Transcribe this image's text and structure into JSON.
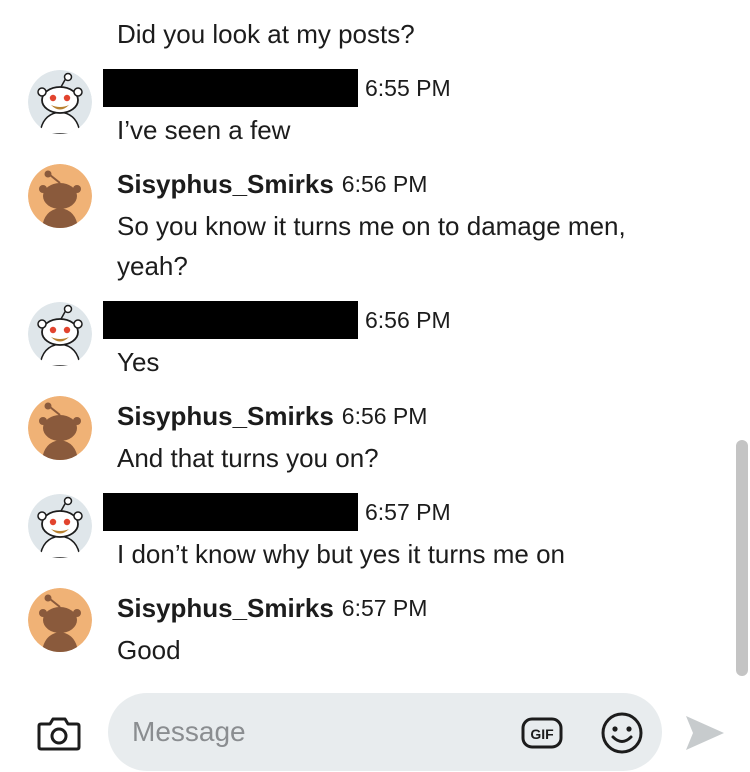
{
  "messages": [
    {
      "type": "continuation",
      "text": "Did you look at my posts?"
    },
    {
      "type": "message",
      "sender": "other",
      "username": "",
      "redacted": true,
      "time": "6:55 PM",
      "text": "I’ve seen a few"
    },
    {
      "type": "message",
      "sender": "self",
      "username": "Sisyphus_Smirks",
      "redacted": false,
      "time": "6:56 PM",
      "text_lines": [
        "So you know it turns me on to damage men,",
        "yeah?"
      ]
    },
    {
      "type": "message",
      "sender": "other",
      "username": "",
      "redacted": true,
      "time": "6:56 PM",
      "text": "Yes"
    },
    {
      "type": "message",
      "sender": "self",
      "username": "Sisyphus_Smirks",
      "redacted": false,
      "time": "6:56 PM",
      "text": "And that turns you on?"
    },
    {
      "type": "message",
      "sender": "other",
      "username": "",
      "redacted": true,
      "time": "6:57 PM",
      "text": "I don’t know why but yes it turns me on"
    },
    {
      "type": "message",
      "sender": "self",
      "username": "Sisyphus_Smirks",
      "redacted": false,
      "time": "6:57 PM",
      "text": "Good"
    }
  ],
  "composer": {
    "placeholder": "Message",
    "value": "",
    "gif_label": "GIF",
    "icons": [
      "camera-icon",
      "gif-icon",
      "emoji-icon",
      "send-icon"
    ]
  },
  "colors": {
    "self_avatar_bg": "#f0b276",
    "other_avatar_bg": "#dfe6ea",
    "composer_bg": "#e8ecee",
    "send_disabled": "#c7cbcd",
    "scroll_thumb": "#c4c4c4"
  }
}
